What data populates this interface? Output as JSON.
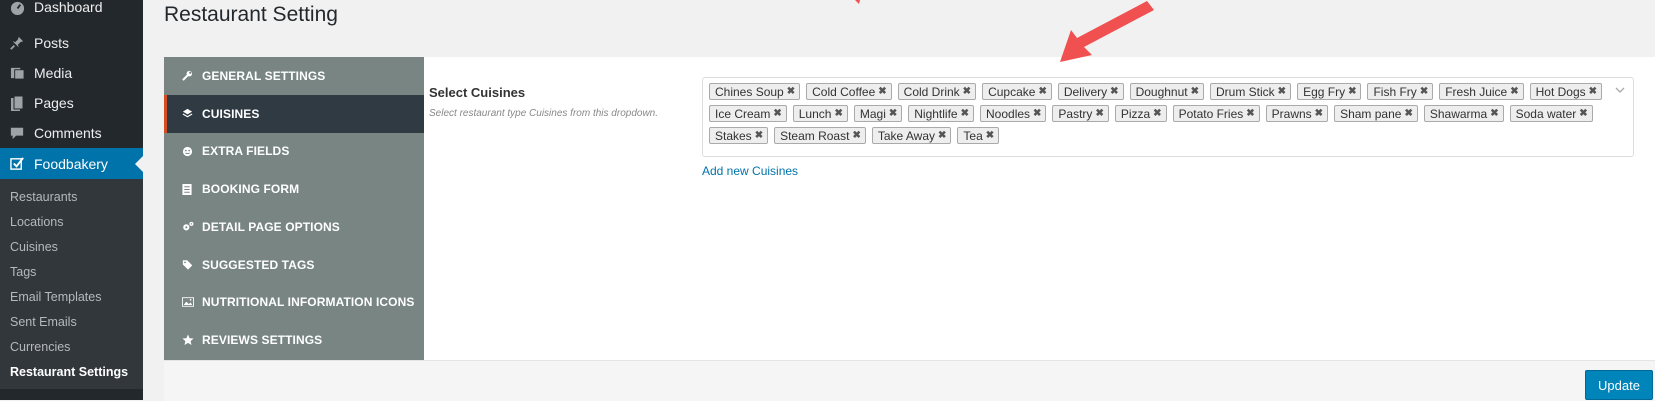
{
  "sidebar": {
    "top_items": [
      {
        "label": "Dashboard",
        "icon": "dashboard-icon"
      },
      {
        "label": "Posts",
        "icon": "pin-icon"
      },
      {
        "label": "Media",
        "icon": "media-icon"
      },
      {
        "label": "Pages",
        "icon": "page-icon"
      },
      {
        "label": "Comments",
        "icon": "comment-icon"
      },
      {
        "label": "Foodbakery",
        "icon": "checkbox-icon"
      }
    ],
    "submenu": [
      "Restaurants",
      "Locations",
      "Cuisines",
      "Tags",
      "Email Templates",
      "Sent Emails",
      "Currencies",
      "Restaurant Settings"
    ]
  },
  "page": {
    "title": "Restaurant Setting"
  },
  "tabs": [
    {
      "label": "GENERAL SETTINGS",
      "icon": "wrench-icon"
    },
    {
      "label": "CUISINES",
      "icon": "layers-icon"
    },
    {
      "label": "EXTRA FIELDS",
      "icon": "smiley-icon"
    },
    {
      "label": "BOOKING FORM",
      "icon": "list-icon"
    },
    {
      "label": "DETAIL PAGE OPTIONS",
      "icon": "gears-icon"
    },
    {
      "label": "SUGGESTED TAGS",
      "icon": "tags-icon"
    },
    {
      "label": "NUTRITIONAL INFORMATION ICONS",
      "icon": "image-icon"
    },
    {
      "label": "REVIEWS SETTINGS",
      "icon": "star-icon"
    }
  ],
  "field": {
    "label": "Select Cuisines",
    "description": "Select restaurant type Cuisines from this dropdown.",
    "tags": [
      "Chines Soup",
      "Cold Coffee",
      "Cold Drink",
      "Cupcake",
      "Delivery",
      "Doughnut",
      "Drum Stick",
      "Egg Fry",
      "Fish Fry",
      "Fresh Juice",
      "Hot Dogs",
      "Ice Cream",
      "Lunch",
      "Magi",
      "Nightlife",
      "Noodles",
      "Pastry",
      "Pizza",
      "Potato Fries",
      "Prawns",
      "Sham pane",
      "Shawarma",
      "Soda water",
      "Stakes",
      "Steam Roast",
      "Take Away",
      "Tea"
    ],
    "remove_glyph": "✖",
    "add_new_label": "Add new Cuisines"
  },
  "update_label": "Update",
  "colors": {
    "sidebar": "#23282d",
    "accent": "#0073aa",
    "tabs": "#788583",
    "annotation": "#f05050"
  }
}
